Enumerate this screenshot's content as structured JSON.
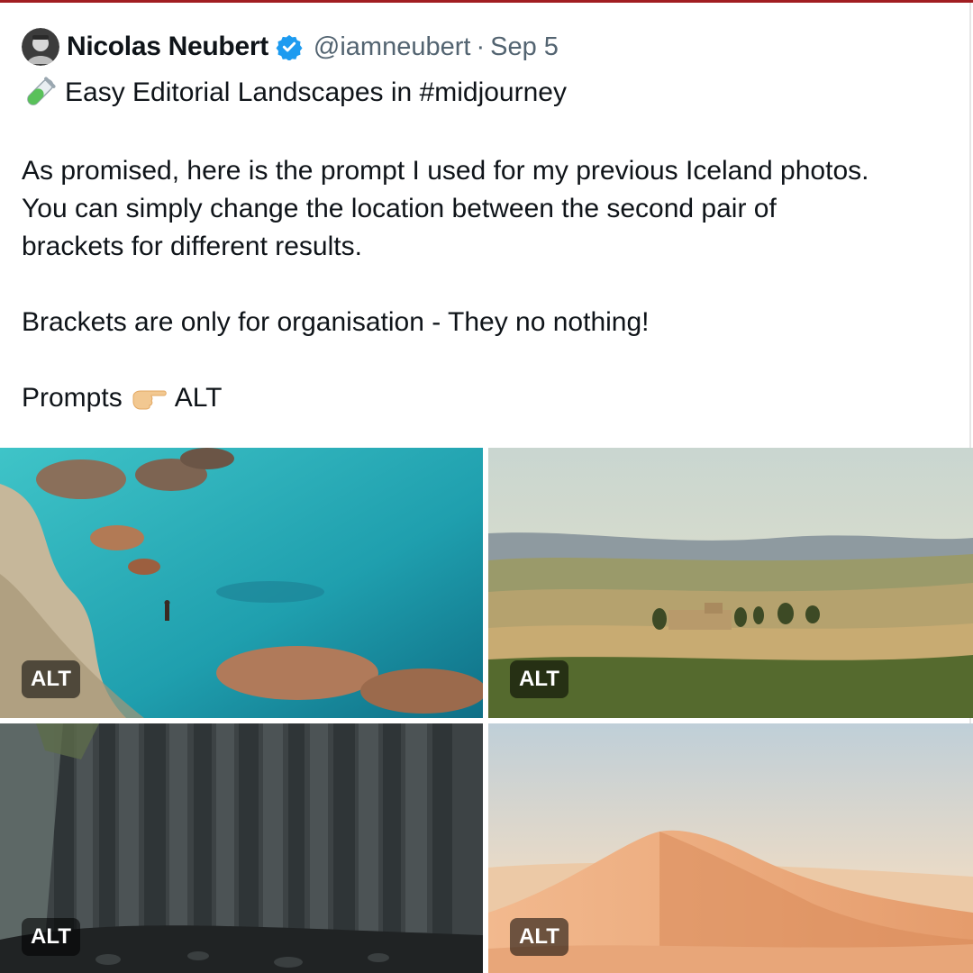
{
  "tweet": {
    "author_name": "Nicolas Neubert",
    "handle": "@iamneubert",
    "separator": "·",
    "date": "Sep 5",
    "title_icon": "test-tube-icon",
    "title": "Easy Editorial Landscapes in #midjourney",
    "paragraph_1": "As promised, here is the prompt I used for my previous Iceland photos.\nYou can simply change the location between the second pair of\nbrackets for different results.",
    "paragraph_2": "Brackets are only for organisation - They no nothing!",
    "prompts_label": "Prompts",
    "prompts_icon": "pointing-hand-icon",
    "prompts_suffix": "ALT"
  },
  "media": {
    "images": [
      {
        "name": "turquoise-coast-image",
        "alt_badge": "ALT"
      },
      {
        "name": "rolling-hills-villa-image",
        "alt_badge": "ALT"
      },
      {
        "name": "basalt-columns-image",
        "alt_badge": "ALT"
      },
      {
        "name": "desert-dune-image",
        "alt_badge": "ALT"
      }
    ]
  },
  "colors": {
    "text_primary": "#0f1419",
    "text_secondary": "#536471",
    "verified_blue": "#1d9bf0",
    "top_accent": "#a11d21"
  }
}
